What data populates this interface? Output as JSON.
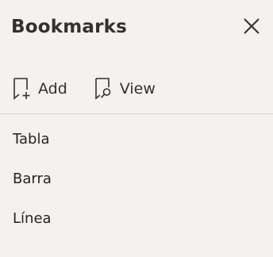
{
  "pane": {
    "title": "Bookmarks",
    "close_icon": "close-icon"
  },
  "toolbar": {
    "add_label": "Add",
    "add_icon": "bookmark-add-icon",
    "view_label": "View",
    "view_icon": "bookmark-view-icon"
  },
  "bookmarks": {
    "items": [
      {
        "label": "Tabla"
      },
      {
        "label": "Barra"
      },
      {
        "label": "Línea"
      }
    ]
  },
  "colors": {
    "background": "#f3f2f1",
    "text": "#252423",
    "divider": "#d2d0ce"
  }
}
